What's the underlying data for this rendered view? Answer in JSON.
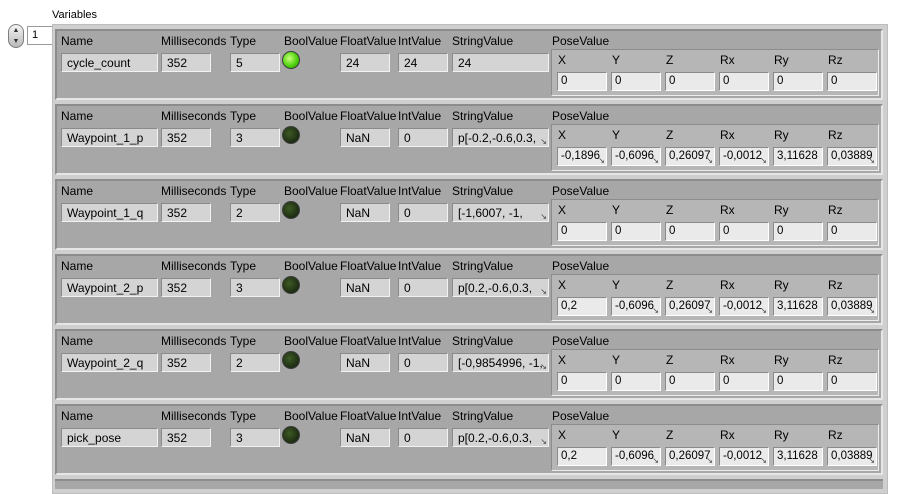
{
  "title": "Variables",
  "index": "1",
  "headers": {
    "name": "Name",
    "ms": "Milliseconds",
    "type": "Type",
    "bool": "BoolValue",
    "float": "FloatValue",
    "int": "IntValue",
    "str": "StringValue",
    "pose": "PoseValue",
    "pose_axes": [
      "X",
      "Y",
      "Z",
      "Rx",
      "Ry",
      "Rz"
    ]
  },
  "colors": {
    "led_on": "#4fd20f",
    "led_off": "#1c2c12",
    "record_bg": "#a7a7a7"
  },
  "records": [
    {
      "name": "cycle_count",
      "ms": "352",
      "type": "5",
      "bool": true,
      "float": "24",
      "int": "24",
      "str": "24",
      "str_trunc": false,
      "pose": [
        "0",
        "0",
        "0",
        "0",
        "0",
        "0"
      ],
      "pose_trunc": [
        false,
        false,
        false,
        false,
        false,
        false
      ]
    },
    {
      "name": "Waypoint_1_p",
      "ms": "352",
      "type": "3",
      "bool": false,
      "float": "NaN",
      "int": "0",
      "str": "p[-0.2,-0.6,0.3,",
      "str_trunc": true,
      "pose": [
        "-0,1896",
        "-0,6096",
        "0,26097",
        "-0,0012",
        "3,11628",
        "0,03889"
      ],
      "pose_trunc": [
        true,
        true,
        true,
        true,
        false,
        true
      ]
    },
    {
      "name": "Waypoint_1_q",
      "ms": "352",
      "type": "2",
      "bool": false,
      "float": "NaN",
      "int": "0",
      "str": "[-1,6007, -1,",
      "str_trunc": true,
      "pose": [
        "0",
        "0",
        "0",
        "0",
        "0",
        "0"
      ],
      "pose_trunc": [
        false,
        false,
        false,
        false,
        false,
        false
      ]
    },
    {
      "name": "Waypoint_2_p",
      "ms": "352",
      "type": "3",
      "bool": false,
      "float": "NaN",
      "int": "0",
      "str": "p[0.2,-0.6,0.3,",
      "str_trunc": true,
      "pose": [
        "0,2",
        "-0,6096",
        "0,26097",
        "-0,0012",
        "3,11628",
        "0,03889"
      ],
      "pose_trunc": [
        false,
        true,
        true,
        true,
        false,
        true
      ]
    },
    {
      "name": "Waypoint_2_q",
      "ms": "352",
      "type": "2",
      "bool": false,
      "float": "NaN",
      "int": "0",
      "str": "[-0,9854996, -1,",
      "str_trunc": true,
      "pose": [
        "0",
        "0",
        "0",
        "0",
        "0",
        "0"
      ],
      "pose_trunc": [
        false,
        false,
        false,
        false,
        false,
        false
      ]
    },
    {
      "name": "pick_pose",
      "ms": "352",
      "type": "3",
      "bool": false,
      "float": "NaN",
      "int": "0",
      "str": "p[0.2,-0.6,0.3,",
      "str_trunc": true,
      "pose": [
        "0,2",
        "-0,6096",
        "0,26097",
        "-0,0012",
        "3,11628",
        "0,03889"
      ],
      "pose_trunc": [
        false,
        true,
        true,
        true,
        false,
        true
      ]
    }
  ]
}
